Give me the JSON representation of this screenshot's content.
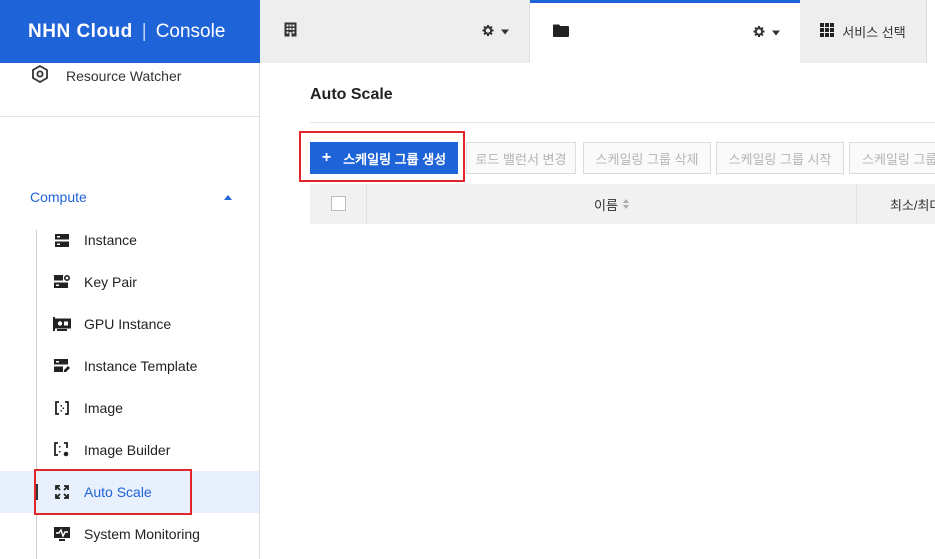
{
  "header": {
    "brand": "NHN Cloud",
    "product": "Console",
    "org_selector": {
      "icon": "building-icon"
    },
    "project_selector": {
      "icon": "folder-icon"
    },
    "service_select_label": "서비스 선택"
  },
  "sidebar": {
    "resource_watcher": "Resource Watcher",
    "section_title": "Compute",
    "items": [
      {
        "label": "Instance",
        "icon": "server-icon"
      },
      {
        "label": "Key Pair",
        "icon": "key-pair-icon"
      },
      {
        "label": "GPU Instance",
        "icon": "gpu-icon"
      },
      {
        "label": "Instance Template",
        "icon": "template-icon"
      },
      {
        "label": "Image",
        "icon": "image-icon"
      },
      {
        "label": "Image Builder",
        "icon": "image-builder-icon"
      },
      {
        "label": "Auto Scale",
        "icon": "auto-scale-icon",
        "active": true
      },
      {
        "label": "System Monitoring",
        "icon": "monitoring-icon"
      }
    ]
  },
  "main": {
    "title": "Auto Scale",
    "toolbar": {
      "create_label": "스케일링 그룹 생성",
      "create_icon": "+",
      "change_lb_label": "로드 밸런서 변경",
      "delete_label": "스케일링 그룹 삭제",
      "start_label": "스케일링 그룹 시작",
      "stop_label": "스케일링 그룹"
    },
    "table": {
      "columns": [
        "이름",
        "최소/최대"
      ]
    }
  },
  "colors": {
    "brand_blue": "#1f63d8",
    "highlight_red": "#e0262b",
    "active_bg": "#e8f0fd"
  }
}
